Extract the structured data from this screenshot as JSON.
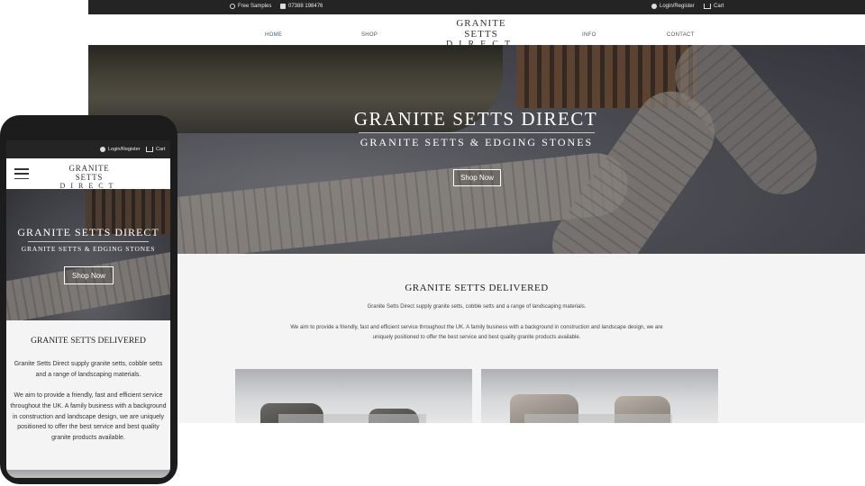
{
  "desktop": {
    "topbar": {
      "free_samples": "Free Samples",
      "phone": "07388 198476",
      "login": "Login/Register",
      "cart": "Cart"
    },
    "nav": {
      "home": "HOME",
      "shop": "SHOP",
      "info": "INFO",
      "contact": "CONTACT"
    },
    "logo": {
      "line1": "GRANITE SETTS",
      "line2": "DIRECT"
    },
    "hero": {
      "title": "GRANITE SETTS DIRECT",
      "subtitle": "GRANITE SETTS & EDGING STONES",
      "button": "Shop Now"
    },
    "section": {
      "title": "GRANITE SETTS DELIVERED",
      "p1": "Granite Setts Direct supply granite setts, cobble setts and a range of landscaping materials.",
      "p2": "We aim to provide a friendly, fast and efficient service throughout the UK. A family business with a background in construction and landscape design, we are uniquely positioned to offer the best service and best quality granite products available."
    }
  },
  "mobile": {
    "topbar": {
      "login": "Login/Register",
      "cart": "Cart"
    },
    "logo": {
      "line1": "GRANITE SETTS",
      "line2": "DIRECT"
    },
    "hero": {
      "title": "GRANITE SETTS DIRECT",
      "subtitle": "GRANITE SETTS & EDGING STONES",
      "button": "Shop Now"
    },
    "section": {
      "title": "GRANITE SETTS DELIVERED",
      "p1": "Granite Setts Direct supply granite setts, cobble setts and a range of landscaping materials.",
      "p2": "We aim to provide a friendly, fast and efficient service throughout the UK. A family business with a background in construction and landscape design, we are uniquely positioned to offer the best service and best quality granite products available."
    }
  },
  "icons": {
    "free_samples": "box-icon",
    "phone": "phone-icon",
    "login": "user-icon",
    "cart": "cart-icon",
    "menu": "hamburger-menu-icon"
  },
  "colors": {
    "topbar": "#242424",
    "nav_active": "#3a5a8a",
    "section_bg": "#f4f4f4"
  }
}
